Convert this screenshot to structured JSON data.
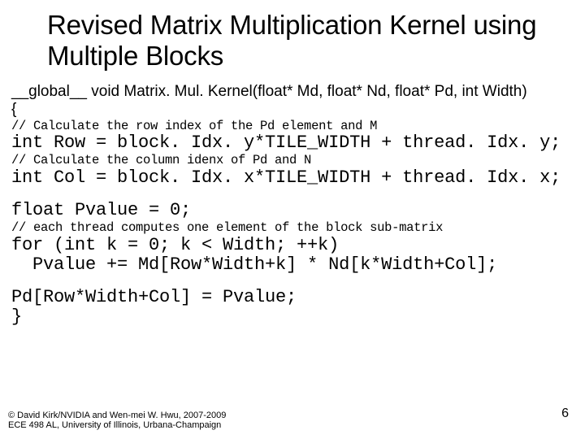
{
  "title": "Revised Matrix Multiplication Kernel using Multiple Blocks",
  "code": {
    "signature": "__global__ void Matrix. Mul. Kernel(float* Md, float* Nd, float* Pd, int Width)",
    "brace_open": "{",
    "comment_row": "// Calculate the row index of the Pd element and M",
    "row_line": "int Row = block. Idx. y*TILE_WIDTH + thread. Idx. y;",
    "comment_col": "// Calculate the column idenx of Pd and N",
    "col_line": "int Col = block. Idx. x*TILE_WIDTH + thread. Idx. x;",
    "pvalue_init": "float Pvalue = 0;",
    "comment_loop": "// each thread computes one element of the block sub-matrix",
    "for_line": "for (int k = 0; k < Width; ++k)",
    "loop_body": "  Pvalue += Md[Row*Width+k] * Nd[k*Width+Col];",
    "assign_line": "Pd[Row*Width+Col] = Pvalue;",
    "brace_close": "}"
  },
  "footer": {
    "line1": "© David Kirk/NVIDIA and Wen-mei W. Hwu, 2007-2009",
    "line2": "ECE 498 AL, University of Illinois, Urbana-Champaign"
  },
  "page_number": "6"
}
